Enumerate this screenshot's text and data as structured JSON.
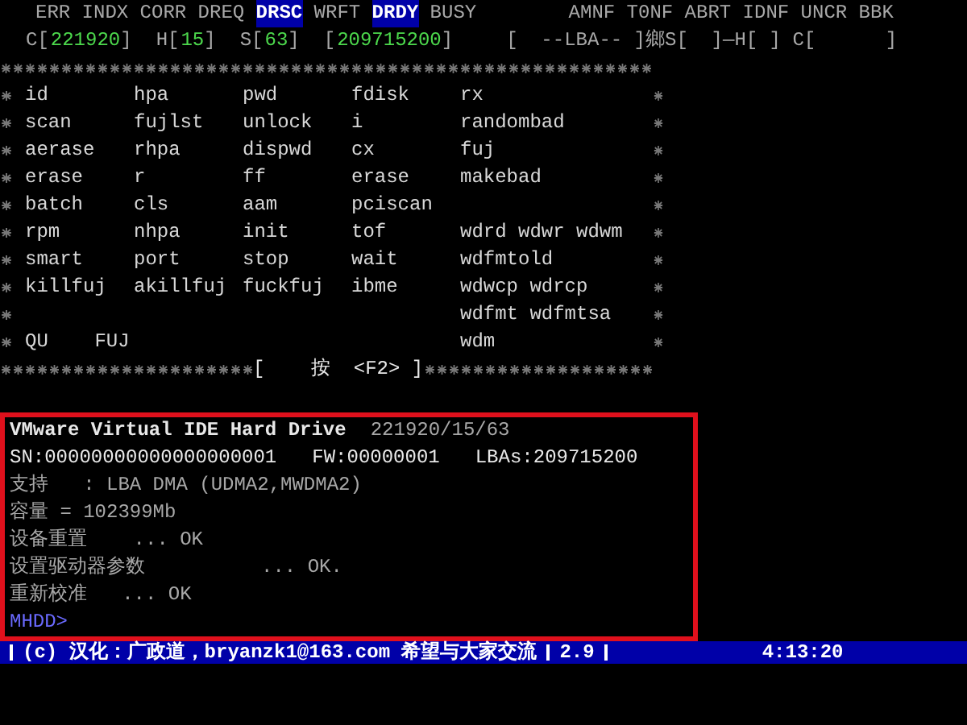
{
  "flags": [
    {
      "label": "ERR",
      "on": false
    },
    {
      "label": "INDX",
      "on": false
    },
    {
      "label": "CORR",
      "on": false
    },
    {
      "label": "DREQ",
      "on": false
    },
    {
      "label": "DRSC",
      "on": true
    },
    {
      "label": "WRFT",
      "on": false
    },
    {
      "label": "DRDY",
      "on": true
    },
    {
      "label": "BUSY",
      "on": false
    },
    {
      "label": "AMNF",
      "on": false
    },
    {
      "label": "T0NF",
      "on": false
    },
    {
      "label": "ABRT",
      "on": false
    },
    {
      "label": "IDNF",
      "on": false
    },
    {
      "label": "UNCR",
      "on": false
    },
    {
      "label": "BBK",
      "on": false
    }
  ],
  "registers": [
    {
      "label": "C[",
      "value": "221920",
      "close": "]"
    },
    {
      "label": "H[",
      "value": "15",
      "close": "]"
    },
    {
      "label": "S[",
      "value": "63",
      "close": "]"
    },
    {
      "label": "[",
      "value": "209715200",
      "close": "]"
    }
  ],
  "position_readout": "[  --LBA-- ]鄉S[  ]—H[ ] C[      ]",
  "command_rows": [
    [
      "id",
      "hpa",
      "pwd",
      "fdisk",
      "rx"
    ],
    [
      "scan",
      "fujlst",
      "unlock",
      "i",
      "randombad"
    ],
    [
      "aerase",
      "rhpa",
      "dispwd",
      "cx",
      "fuj"
    ],
    [
      "erase",
      "r",
      "ff",
      "erase",
      "makebad"
    ],
    [
      "batch",
      "cls",
      "aam",
      "pciscan",
      ""
    ],
    [
      "rpm",
      "nhpa",
      "init",
      "tof",
      "wdrd wdwr wdwm"
    ],
    [
      "smart",
      "port",
      "stop",
      "wait",
      "wdfmtold"
    ],
    [
      "killfuj",
      "akillfuj",
      "fuckfuj",
      "ibme",
      "wdwcp wdrcp"
    ],
    [
      "",
      "",
      "",
      "",
      "wdfmt wdfmtsa"
    ],
    [
      "QU    FUJ",
      "",
      "",
      "",
      "wdm"
    ]
  ],
  "menu_hint": "[    按  <F2> ]",
  "console": [
    {
      "kind": "title",
      "text": "VMware Virtual IDE Hard Drive",
      "extra": "221920/15/63"
    },
    {
      "kind": "ids",
      "parts": [
        "SN:00000000000000000001",
        "FW:00000001",
        "LBAs:209715200"
      ]
    },
    {
      "kind": "line",
      "text": "支持   : LBA DMA (UDMA2,MWDMA2)"
    },
    {
      "kind": "line",
      "text": "容量 = 102399Mb"
    },
    {
      "kind": "line",
      "text": "设备重置    ... OK"
    },
    {
      "kind": "line",
      "text": "设置驱动器参数          ... OK."
    },
    {
      "kind": "line",
      "text": "重新校准   ... OK"
    },
    {
      "kind": "prompt",
      "text": "MHDD>"
    }
  ],
  "status_bar": {
    "credit": "(c) 汉化：广政道，bryanzk1@163.com 希望与大家交流",
    "version": "2.9",
    "time": "4:13:20"
  }
}
